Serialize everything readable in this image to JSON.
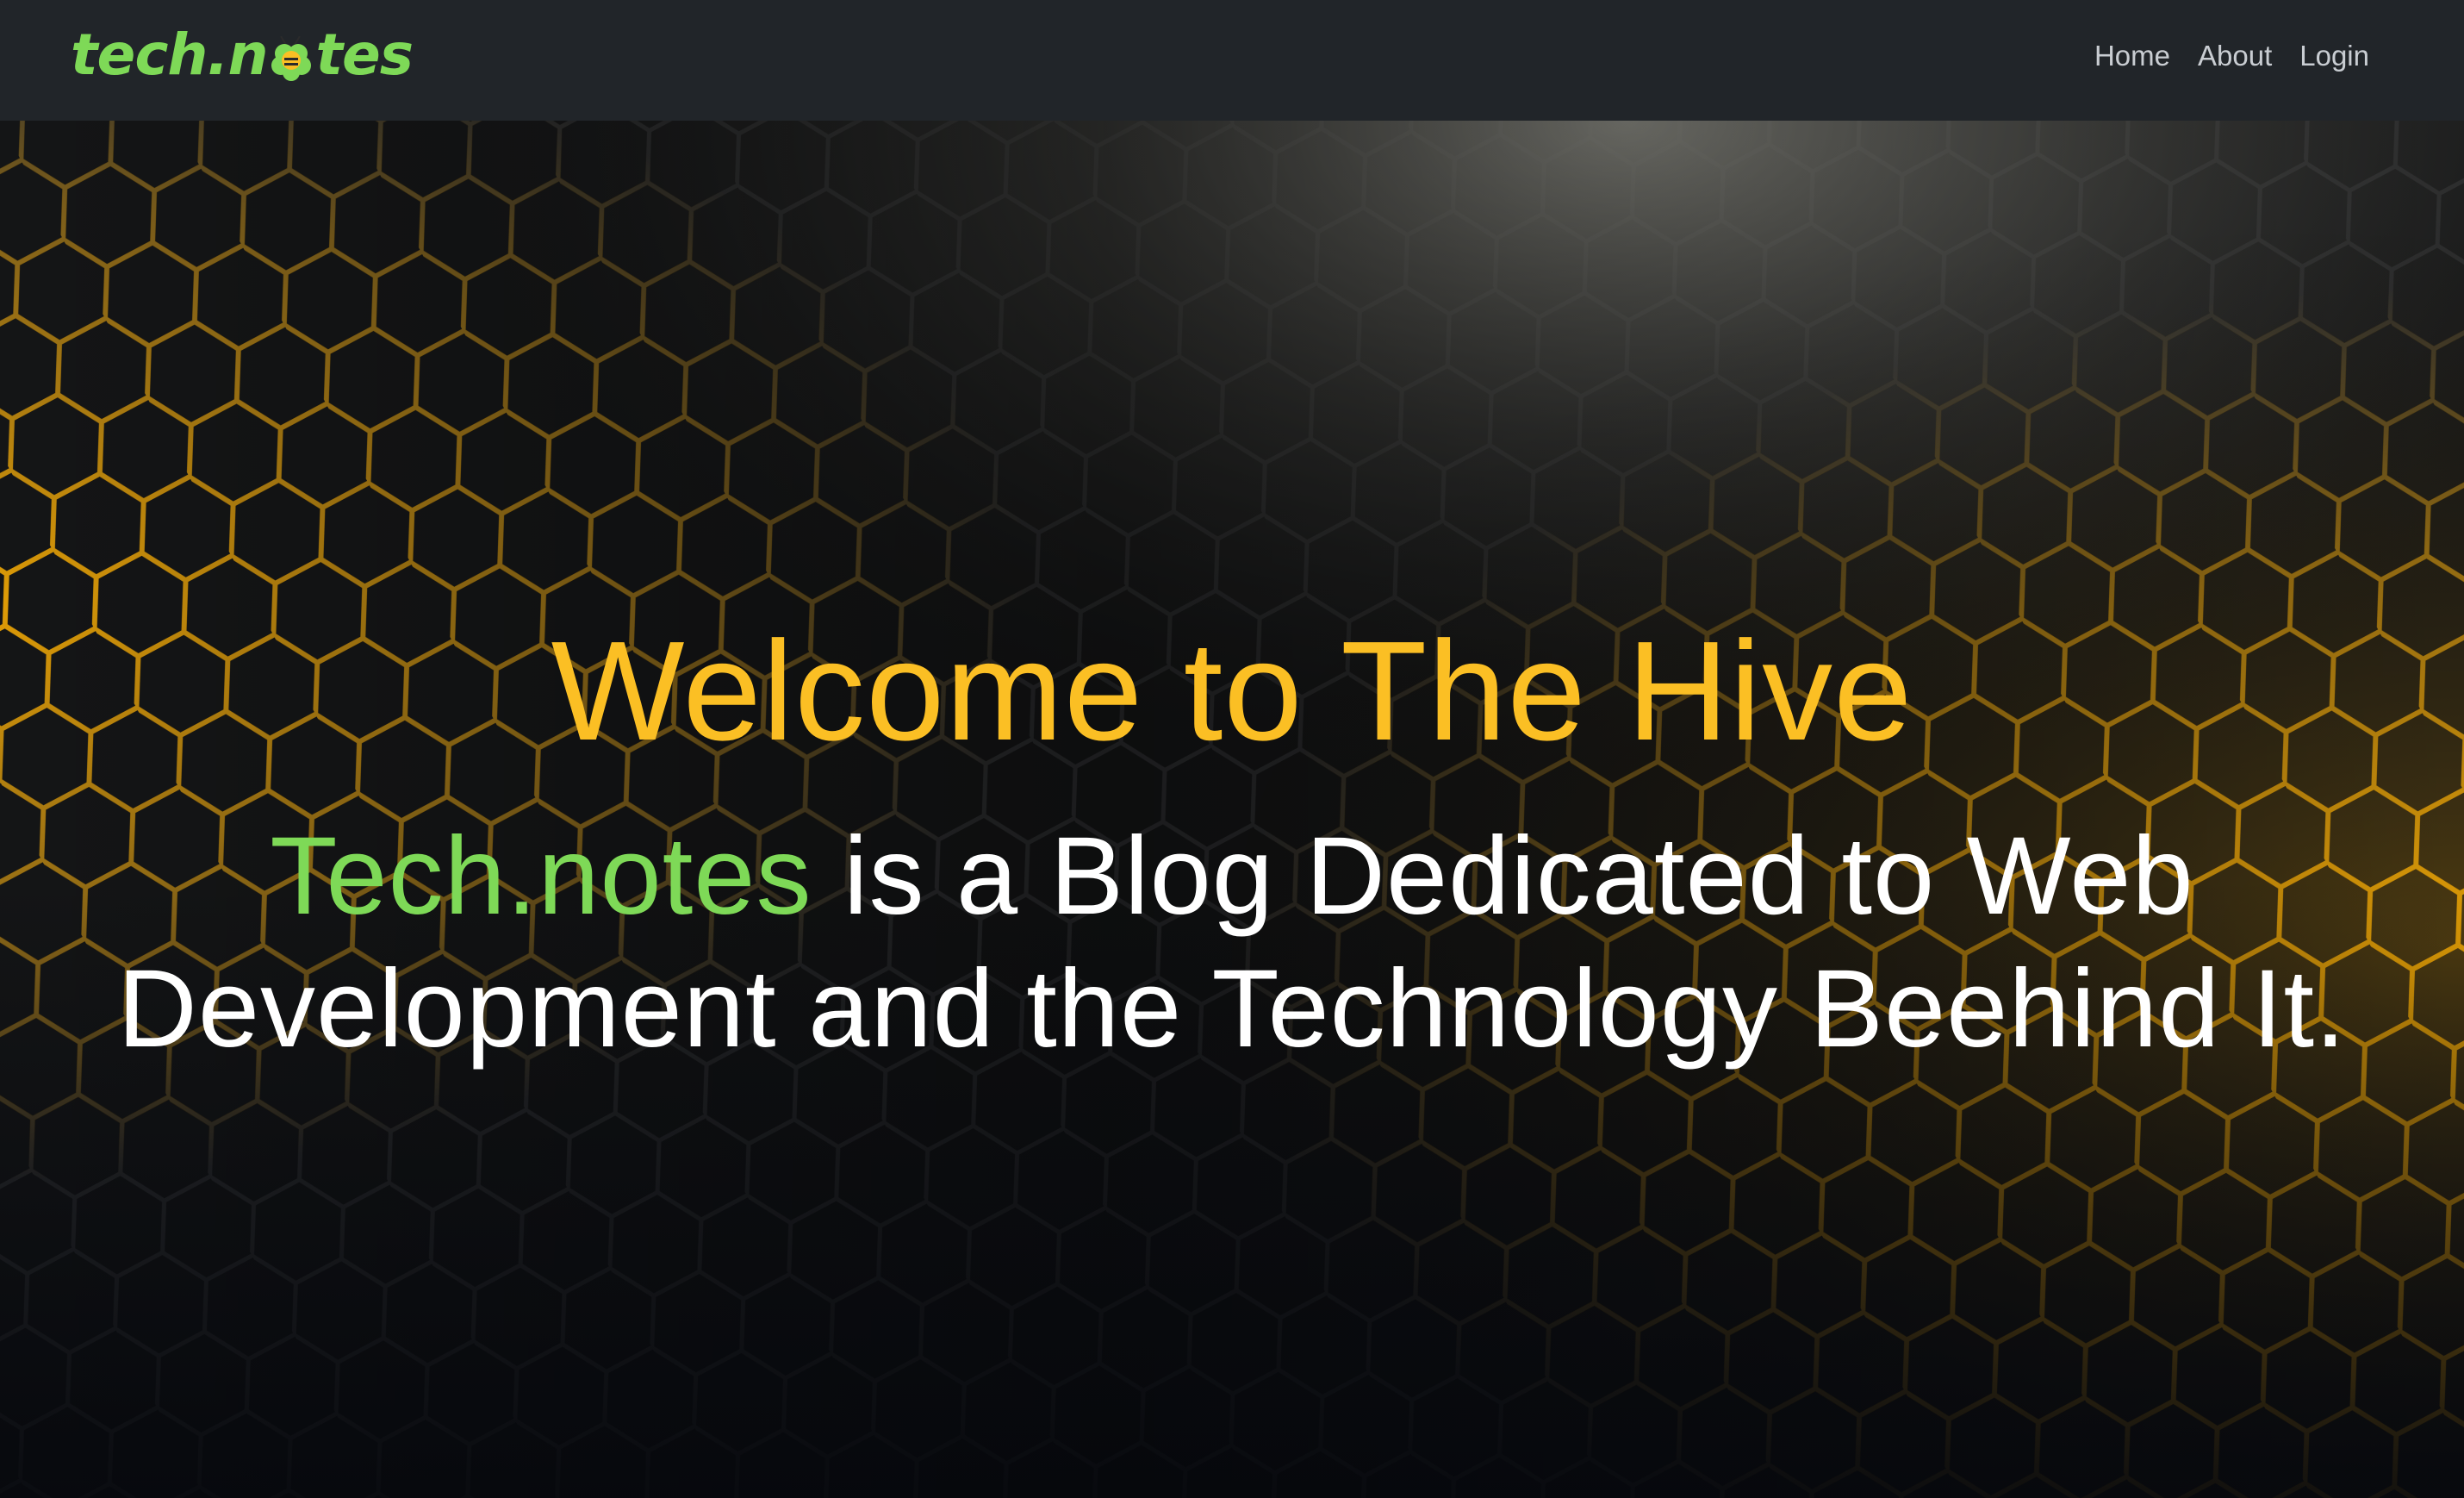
{
  "navbar": {
    "logo": {
      "text_before": "tech.n",
      "text_after": "tes",
      "icon": "bee-icon"
    },
    "links": [
      {
        "label": "Home"
      },
      {
        "label": "About"
      },
      {
        "label": "Login"
      }
    ]
  },
  "hero": {
    "title": "Welcome to The Hive",
    "subtitle": {
      "brand": "Tech.notes",
      "text": " is a Blog Dedicated to Web Development and the Technology Beehind It."
    },
    "background": "honeycomb-background"
  },
  "colors": {
    "navbar_bg": "#212529",
    "brand_green": "#7ed957",
    "title_yellow": "#fbbf24",
    "nav_text": "#c9cdd2",
    "glow_orange": "#ffb000"
  }
}
